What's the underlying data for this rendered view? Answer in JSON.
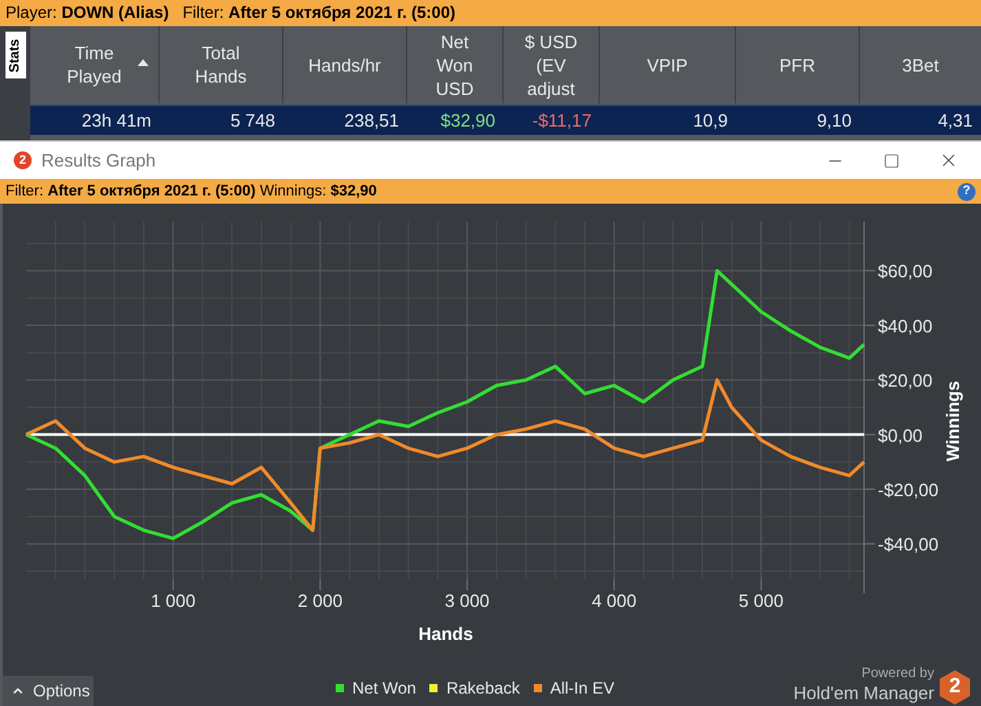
{
  "top_bar": {
    "text": "Player: **DOWN (Alias)**   Filter: **After 5 октября 2021 г. (5:00)**"
  },
  "stats_tab": {
    "label": "Stats"
  },
  "table": {
    "columns": [
      {
        "lines": [
          "Time",
          "Played"
        ],
        "sorted": true
      },
      {
        "lines": [
          "Total",
          "Hands"
        ],
        "sorted": false
      },
      {
        "lines": [
          "Hands/hr"
        ],
        "sorted": false
      },
      {
        "lines": [
          "Net",
          "Won",
          "USD"
        ],
        "sorted": false
      },
      {
        "lines": [
          "$ USD",
          "(EV",
          "adjust"
        ],
        "sorted": false
      },
      {
        "lines": [
          "VPIP"
        ],
        "sorted": false
      },
      {
        "lines": [
          "PFR"
        ],
        "sorted": false
      },
      {
        "lines": [
          "3Bet"
        ],
        "sorted": false
      }
    ],
    "rows": [
      {
        "cells": [
          {
            "text": "23h 41m",
            "color": "#e8e8e8"
          },
          {
            "text": "5 748",
            "color": "#e8e8e8"
          },
          {
            "text": "238,51",
            "color": "#e8e8e8"
          },
          {
            "text": "$32,90",
            "color": "#7fe07f"
          },
          {
            "text": "-$11,17",
            "color": "#f06a6a"
          },
          {
            "text": "10,9",
            "color": "#e8e8e8"
          },
          {
            "text": "9,10",
            "color": "#e8e8e8"
          },
          {
            "text": "4,31",
            "color": "#e8e8e8"
          }
        ]
      }
    ]
  },
  "window": {
    "logo": "2",
    "title": "Results Graph"
  },
  "filter_bar": {
    "text": "Filter: **After 5 октября 2021 г. (5:00)** Winnings: **$32,90**",
    "help": "?"
  },
  "chart": {
    "chart_data": {
      "type": "line",
      "xlabel": "Hands",
      "ylabel": "Winnings",
      "x": [
        0,
        200,
        400,
        600,
        800,
        1000,
        1200,
        1400,
        1600,
        1800,
        1950,
        2000,
        2200,
        2400,
        2600,
        2800,
        3000,
        3200,
        3400,
        3600,
        3800,
        4000,
        4200,
        4400,
        4600,
        4700,
        4800,
        5000,
        5200,
        5400,
        5600,
        5700
      ],
      "series": [
        {
          "name": "Net Won",
          "color": "#33dd33",
          "values": [
            0,
            -5,
            -15,
            -30,
            -35,
            -38,
            -32,
            -25,
            -22,
            -28,
            -35,
            -5,
            0,
            5,
            3,
            8,
            12,
            18,
            20,
            25,
            15,
            18,
            12,
            20,
            25,
            60,
            55,
            45,
            38,
            32,
            28,
            33
          ]
        },
        {
          "name": "Rakeback",
          "color": "#eeee33",
          "values": [
            null,
            null,
            null,
            null,
            null,
            null,
            null,
            null,
            null,
            null,
            null,
            null,
            null,
            null,
            null,
            null,
            null,
            null,
            null,
            null,
            null,
            null,
            null,
            null,
            null,
            null,
            null,
            null,
            null,
            null,
            null,
            null
          ]
        },
        {
          "name": "All-In EV",
          "color": "#f08a2c",
          "values": [
            0,
            5,
            -5,
            -10,
            -8,
            -12,
            -15,
            -18,
            -12,
            -25,
            -35,
            -5,
            -3,
            0,
            -5,
            -8,
            -5,
            0,
            2,
            5,
            2,
            -5,
            -8,
            -5,
            -2,
            20,
            10,
            -2,
            -8,
            -12,
            -15,
            -10
          ]
        }
      ],
      "xlim": [
        0,
        5700
      ],
      "ylim": [
        -53,
        78
      ],
      "grid": true,
      "xticks": [
        {
          "value": 1000,
          "label": "1 000"
        },
        {
          "value": 2000,
          "label": "2 000"
        },
        {
          "value": 3000,
          "label": "3 000"
        },
        {
          "value": 4000,
          "label": "4 000"
        },
        {
          "value": 5000,
          "label": "5 000"
        }
      ],
      "yticks": [
        {
          "value": -40,
          "label": "-$40,00"
        },
        {
          "value": -20,
          "label": "-$20,00"
        },
        {
          "value": 0,
          "label": "$0,00"
        },
        {
          "value": 20,
          "label": "$20,00"
        },
        {
          "value": 40,
          "label": "$40,00"
        },
        {
          "value": 60,
          "label": "$60,00"
        }
      ]
    }
  },
  "options_button": {
    "label": "Options"
  },
  "branding": {
    "powered_by": "Powered by",
    "product": "Hold'em Manager",
    "logo": "2"
  }
}
